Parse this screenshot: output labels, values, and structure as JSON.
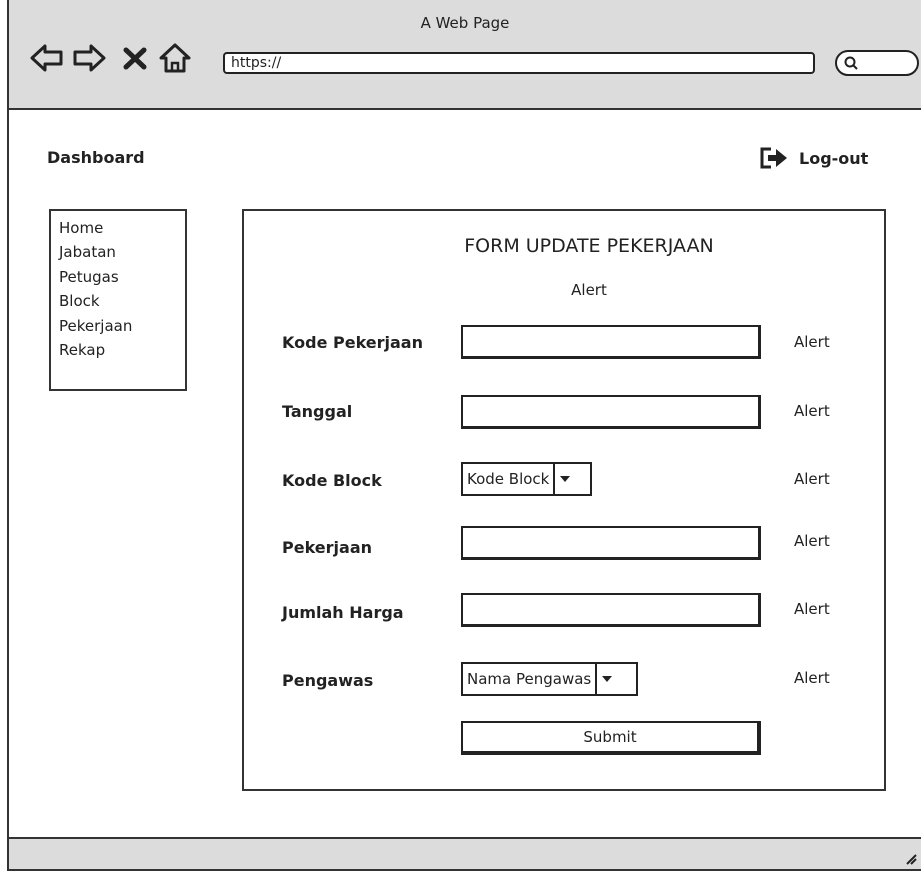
{
  "browser": {
    "title": "A Web Page",
    "url": "https://"
  },
  "header": {
    "dashboard_label": "Dashboard",
    "logout_label": "Log-out"
  },
  "sidebar": {
    "items": [
      {
        "label": "Home"
      },
      {
        "label": "Jabatan"
      },
      {
        "label": "Petugas"
      },
      {
        "label": "Block"
      },
      {
        "label": "Pekerjaan"
      },
      {
        "label": "Rekap"
      }
    ]
  },
  "form": {
    "title": "FORM UPDATE PEKERJAAN",
    "alert": "Alert",
    "fields": {
      "kode_pekerjaan": {
        "label": "Kode Pekerjaan",
        "value": "",
        "alert": "Alert"
      },
      "tanggal": {
        "label": "Tanggal",
        "value": "",
        "alert": "Alert"
      },
      "kode_block": {
        "label": "Kode Block",
        "selected": "Kode Block",
        "alert": "Alert"
      },
      "pekerjaan": {
        "label": "Pekerjaan",
        "value": "",
        "alert": "Alert"
      },
      "jumlah_harga": {
        "label": "Jumlah Harga",
        "value": "",
        "alert": "Alert"
      },
      "pengawas": {
        "label": "Pengawas",
        "selected": "Nama Pengawas",
        "alert": "Alert"
      }
    },
    "submit_label": "Submit"
  }
}
